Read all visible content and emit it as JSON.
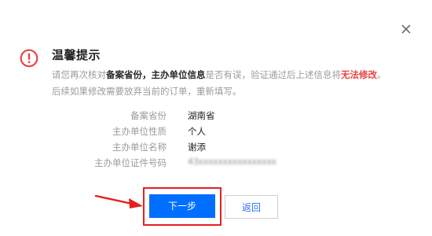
{
  "dialog": {
    "title": "温馨提示",
    "close_icon": "close-icon",
    "warning_icon": "exclamation-circle-icon",
    "description": {
      "part1": "请您再次核对",
      "strong1": "备案省份",
      "part2": "，",
      "strong2": "主办单位信息",
      "part3": "是否有误，验证通过后上述信息将",
      "danger": "无法修改",
      "part4": "。",
      "line2": "后续如果修改需要放弃当前的订单，重新填写。"
    },
    "fields": [
      {
        "label": "备案省份",
        "value": "湖南省"
      },
      {
        "label": "主办单位性质",
        "value": "个人"
      },
      {
        "label": "主办单位名称",
        "value": "谢添"
      },
      {
        "label": "主办单位证件号码",
        "value": "43xxxxxxxxxxxxxxxx"
      }
    ],
    "buttons": {
      "next": "下一步",
      "back": "返回"
    }
  },
  "colors": {
    "primary": "#006eff",
    "danger": "#e54545",
    "warning_icon": "#e54545",
    "annotation_red": "#e4201f"
  }
}
